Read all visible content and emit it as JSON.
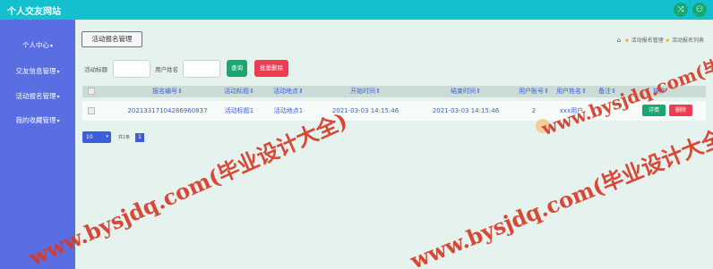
{
  "topbar": {
    "title": "个人交友网站",
    "buttons": [
      "⤨",
      "⚇"
    ]
  },
  "sidebar": {
    "items": [
      {
        "label": "个人中心"
      },
      {
        "label": "交友信息管理"
      },
      {
        "label": "活动报名管理"
      },
      {
        "label": "我的收藏管理"
      }
    ]
  },
  "tab": {
    "label": "活动报名管理"
  },
  "breadcrumb": {
    "home_icon": "⌂",
    "item1": "活动报名管理",
    "item2": "活动报名列表"
  },
  "filters": {
    "activity_title_label": "活动标题",
    "activity_title_value": "",
    "user_name_label": "用户姓名",
    "user_name_value": "",
    "search_label": "查询",
    "batch_delete_label": "批量删除"
  },
  "table": {
    "columns": [
      "报名编号",
      "活动标题",
      "活动地点",
      "开始时间",
      "结束时间",
      "用户账号",
      "用户姓名",
      "备注",
      "操作"
    ],
    "rows": [
      {
        "signup_id": "20213317104286960837",
        "activity_title": "活动标题1",
        "location": "活动地点1",
        "start_time": "2021-03-03 14:15:46",
        "end_time": "2021-03-03 14:15:46",
        "user_account": "2",
        "user_name": "xxx用户",
        "remark": "",
        "detail_label": "详情",
        "delete_label": "删除"
      }
    ]
  },
  "pager": {
    "page_size": "10",
    "total_label": "共1条",
    "current_page": "1"
  },
  "watermarks": [
    "www.bysjdq.com(毕业设计大全)",
    "www.bysjdq.com(毕业设计大全)",
    "www.bysjdq.com(毕业设计大全)"
  ]
}
